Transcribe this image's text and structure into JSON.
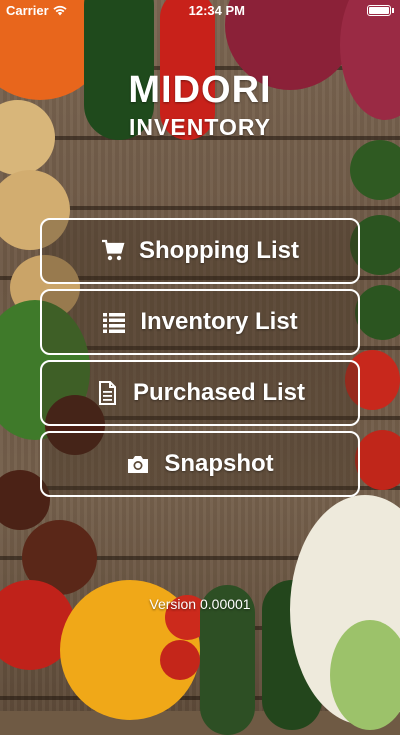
{
  "status_bar": {
    "carrier": "Carrier",
    "time": "12:34 PM"
  },
  "header": {
    "title": "MIDORI",
    "subtitle": "INVENTORY"
  },
  "menu": [
    {
      "label": "Shopping List",
      "icon": "cart-icon"
    },
    {
      "label": "Inventory List",
      "icon": "list-icon"
    },
    {
      "label": "Purchased List",
      "icon": "document-icon"
    },
    {
      "label": "Snapshot",
      "icon": "camera-icon"
    }
  ],
  "footer": {
    "version": "Version 0.00001"
  },
  "colors": {
    "wood": "#6f5a44",
    "text": "#ffffff"
  }
}
